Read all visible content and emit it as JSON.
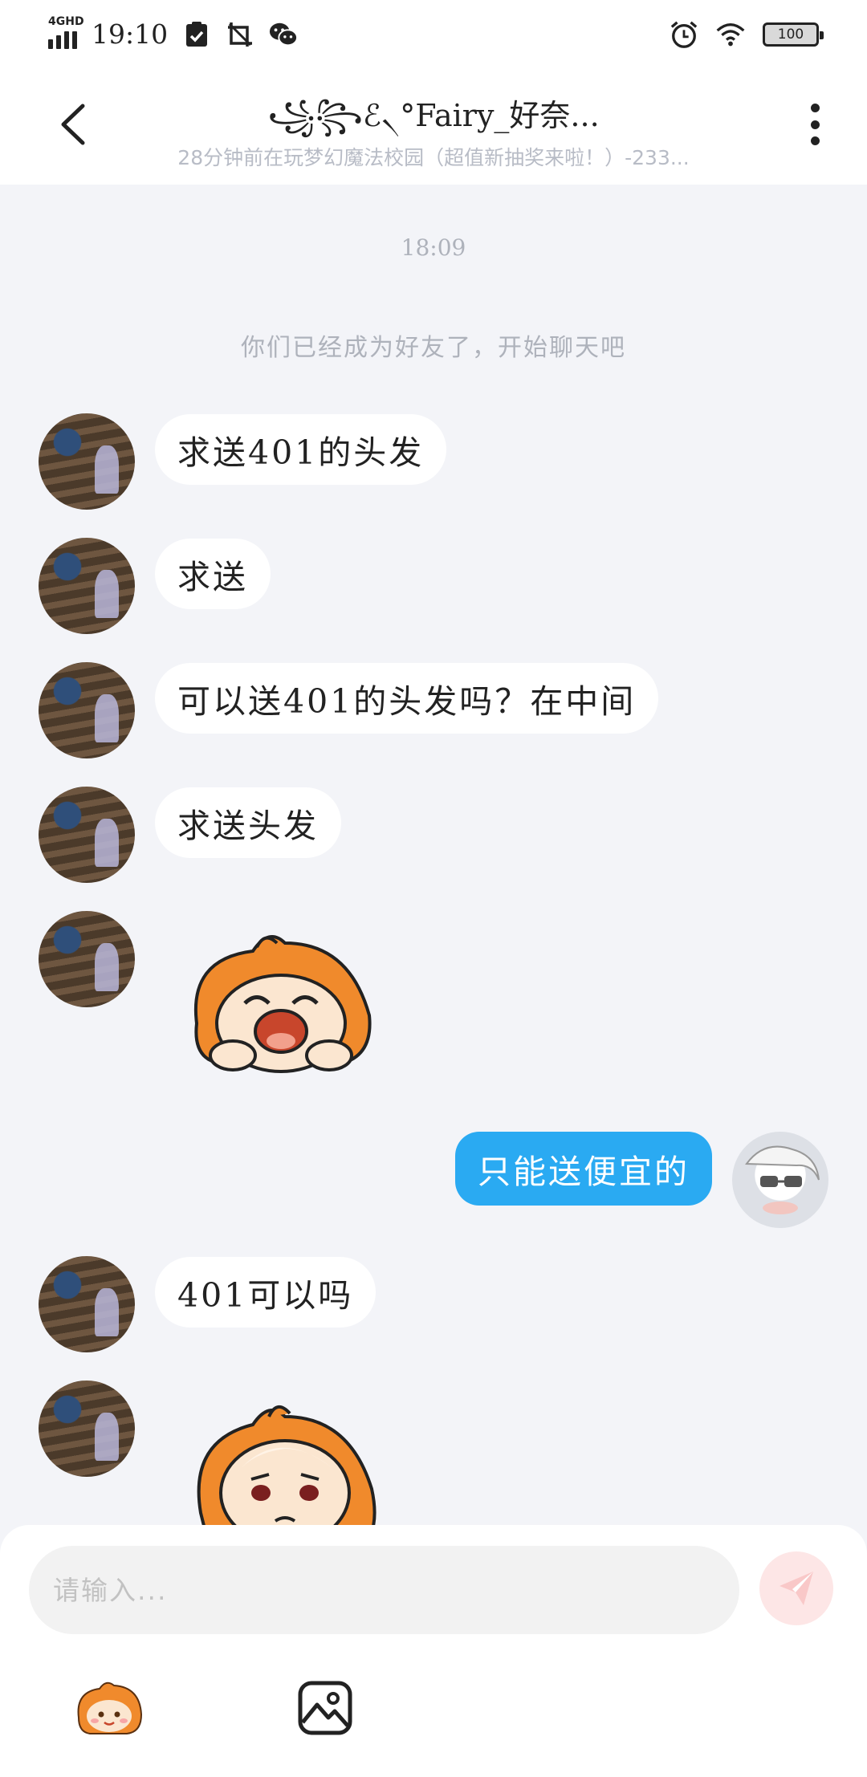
{
  "status_bar": {
    "network": "4GHD",
    "time": "19:10",
    "battery": "100",
    "icons": [
      "signal-icon",
      "check-clipboard-icon",
      "screenshot-off-icon",
      "wechat-icon",
      "alarm-icon",
      "wifi-icon",
      "battery-icon"
    ]
  },
  "header": {
    "title": "꧁꧂ℰ৲°Fairy_好奈...",
    "subtitle": "28分钟前在玩梦幻魔法校园（超值新抽奖来啦！）-233..."
  },
  "chat": {
    "timestamp": "18:09",
    "system_message": "你们已经成为好友了，开始聊天吧",
    "messages": [
      {
        "from": "other",
        "type": "text",
        "text": "求送401的头发"
      },
      {
        "from": "other",
        "type": "text",
        "text": "求送"
      },
      {
        "from": "other",
        "type": "text",
        "text": "可以送401的头发吗？在中间"
      },
      {
        "from": "other",
        "type": "text",
        "text": "求送头发"
      },
      {
        "from": "other",
        "type": "sticker",
        "sticker": "crying-orange-girl-sticker"
      },
      {
        "from": "self",
        "type": "text",
        "text": "只能送便宜的"
      },
      {
        "from": "other",
        "type": "text",
        "text": "401可以吗"
      },
      {
        "from": "other",
        "type": "sticker",
        "sticker": "sad-orange-girl-sticker"
      }
    ]
  },
  "input": {
    "placeholder": "请输入...",
    "send_icon": "paper-plane-icon",
    "tools": [
      "emoji-sticker-icon",
      "image-gallery-icon"
    ]
  },
  "colors": {
    "chat_background": "#f3f4f8",
    "self_bubble": "#2aaaf2",
    "send_button_bg": "#fde6e6",
    "muted_text": "#aeb2bb"
  }
}
